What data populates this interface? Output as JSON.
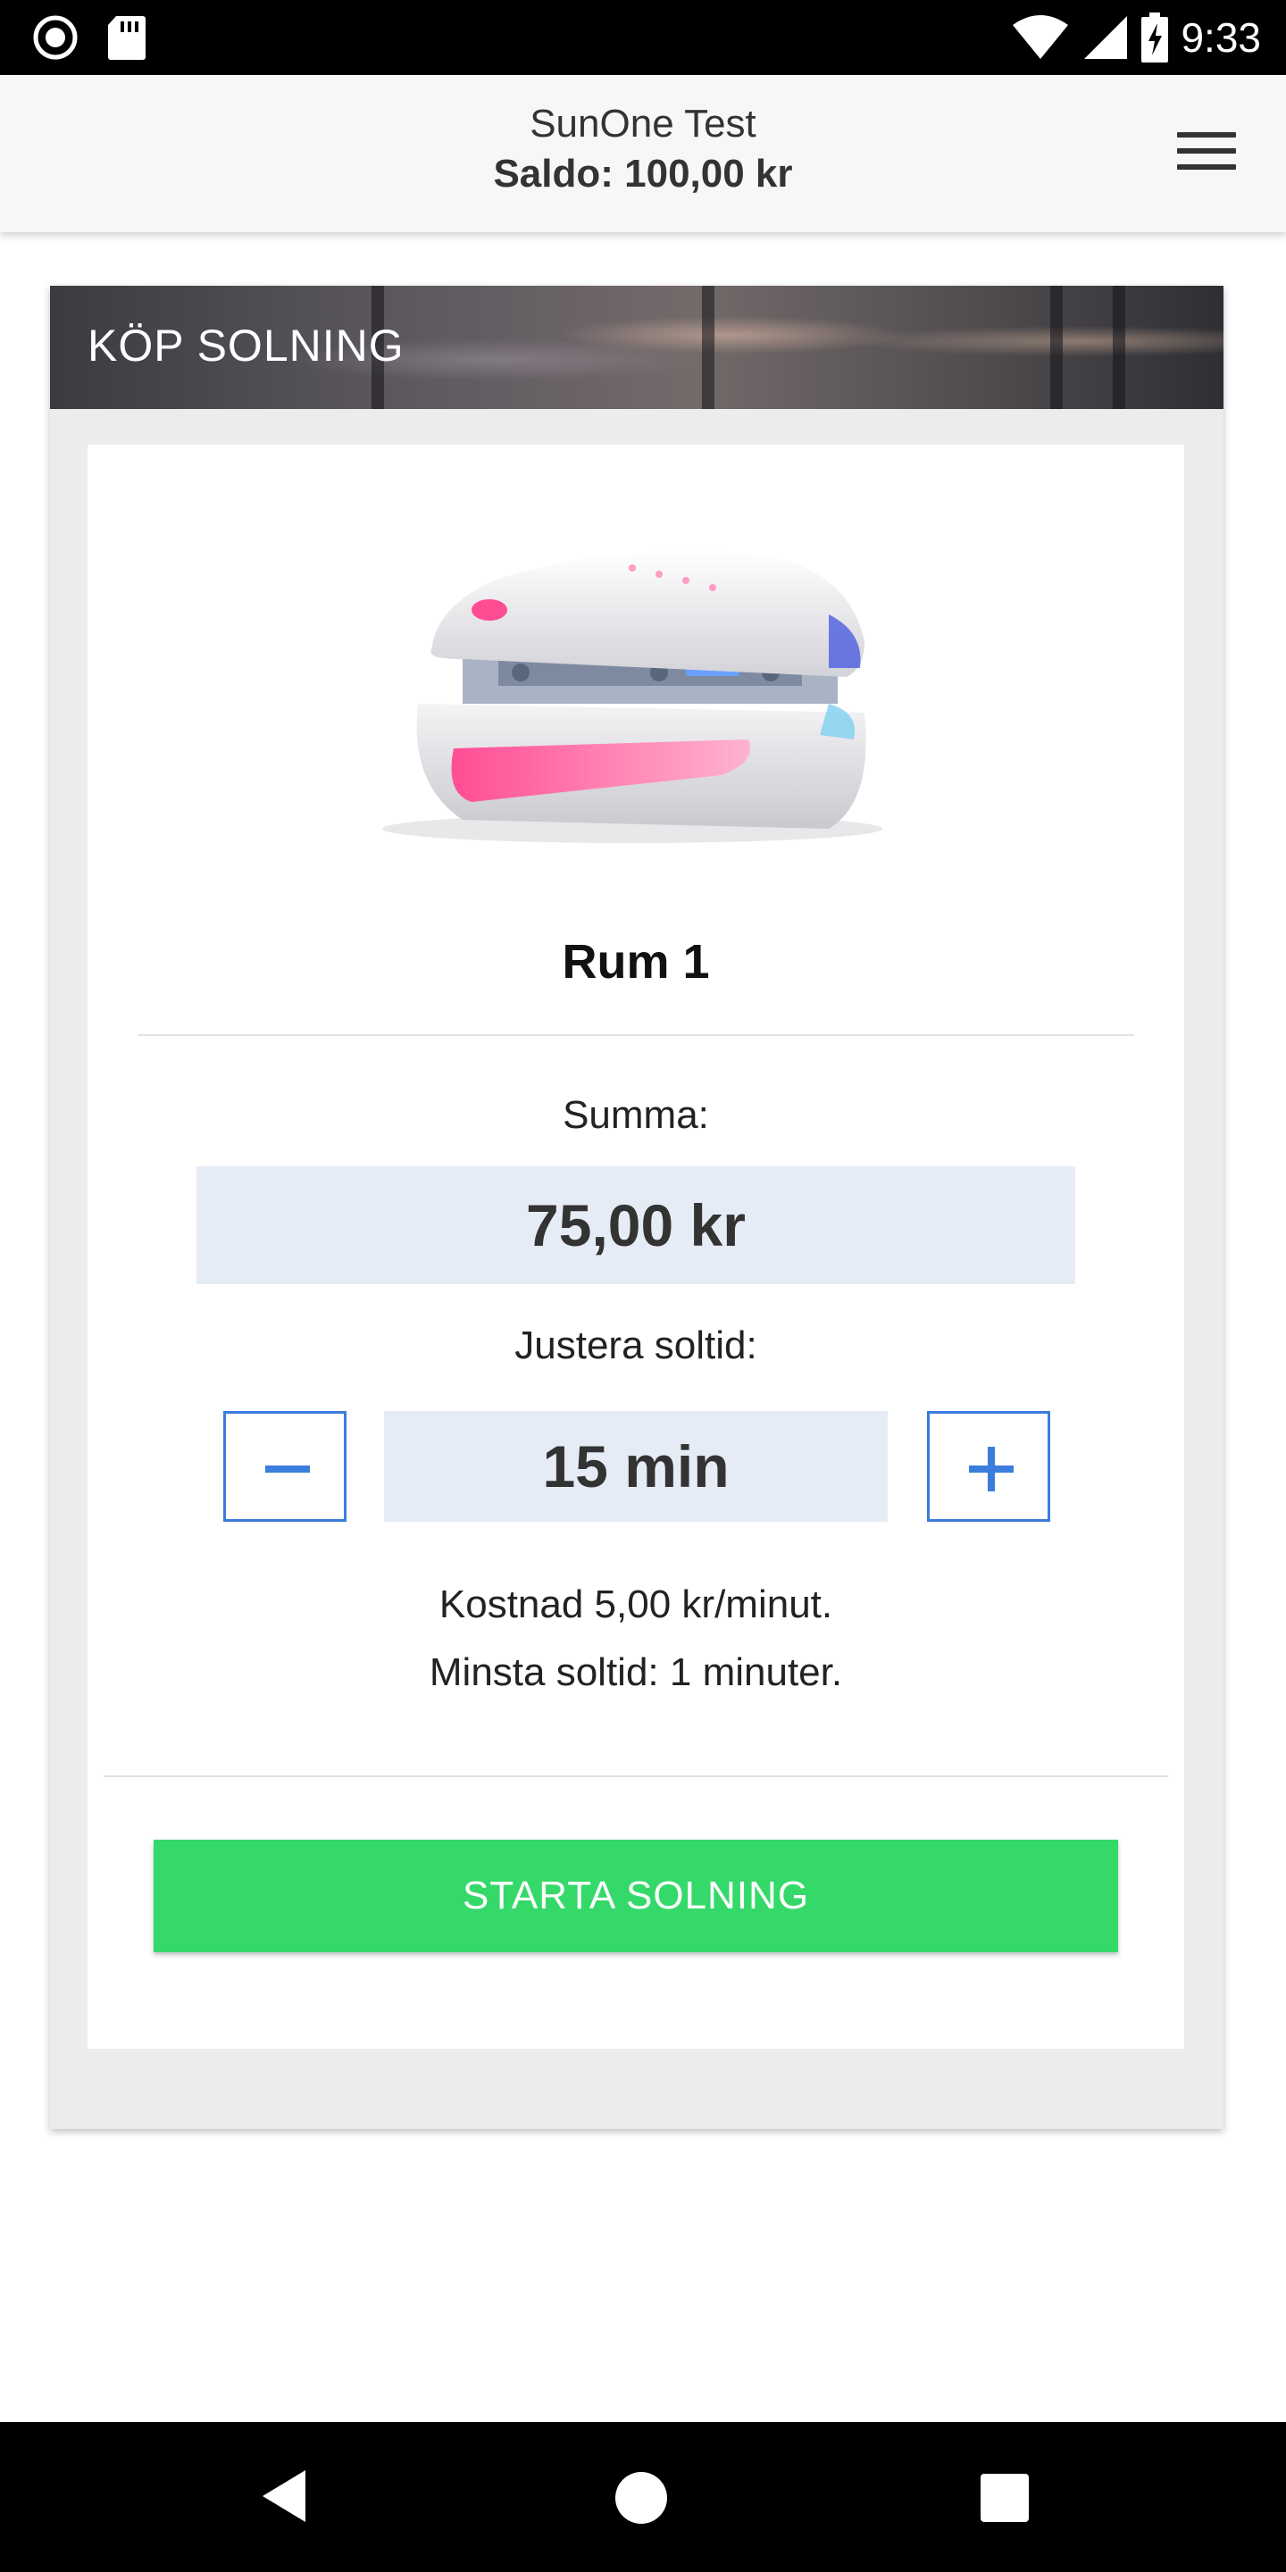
{
  "status_bar": {
    "time": "9:33",
    "left_icons": [
      "record-icon",
      "sd-card-icon"
    ],
    "right_icons": [
      "wifi-icon",
      "signal-icon",
      "battery-charging-icon"
    ]
  },
  "header": {
    "title": "SunOne Test",
    "balance": "Saldo: 100,00 kr",
    "menu_icon": "hamburger-menu-icon"
  },
  "card": {
    "title": "KÖP SOLNING",
    "room_name": "Rum 1",
    "sum_label": "Summa:",
    "sum_value": "75,00 kr",
    "adjust_label": "Justera soltid:",
    "time_value": "15 min",
    "decrease_icon": "minus-icon",
    "increase_icon": "plus-icon",
    "cost_text": "Kostnad 5,00 kr/minut.",
    "min_time_text": "Minsta soltid: 1 minuter.",
    "start_button": "STARTA SOLNING",
    "colors": {
      "accent_blue": "#3b7ddd",
      "value_box_bg": "#e6ecf6",
      "start_button_bg": "#35d96a"
    }
  },
  "nav_bar": {
    "icons": [
      "back-icon",
      "home-icon",
      "recents-icon"
    ]
  }
}
